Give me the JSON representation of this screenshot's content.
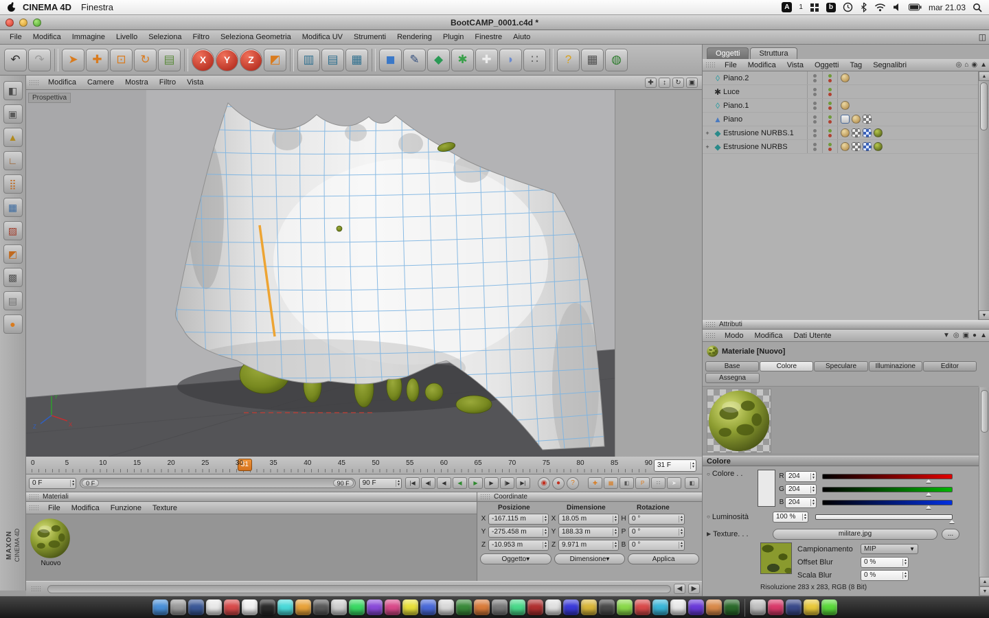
{
  "macbar": {
    "app": "CINEMA 4D",
    "menu": "Finestra",
    "clock": "mar 21.03",
    "input_letter": "A",
    "input_num": "1",
    "b_badge": "b"
  },
  "window": {
    "title": "BootCAMP_0001.c4d *"
  },
  "app_menu": [
    "File",
    "Modifica",
    "Immagine",
    "Livello",
    "Seleziona",
    "Filtro",
    "Seleziona Geometria",
    "Modifica UV",
    "Strumenti",
    "Rendering",
    "Plugin",
    "Finestre",
    "Aiuto"
  ],
  "toolbar": [
    {
      "n": "undo-icon",
      "g": "↶",
      "c": "#2f2f2f"
    },
    {
      "n": "redo-icon",
      "g": "↷",
      "c": "#9a9a9a"
    },
    {
      "sep": true
    },
    {
      "n": "live-selection-icon",
      "g": "➤",
      "c": "#d97b1e"
    },
    {
      "n": "move-icon",
      "g": "✚",
      "c": "#d97b1e"
    },
    {
      "n": "scale-icon",
      "g": "⊡",
      "c": "#d97b1e"
    },
    {
      "n": "rotate-icon",
      "g": "↻",
      "c": "#d97b1e"
    },
    {
      "n": "last-tool-icon",
      "g": "▤",
      "c": "#5a8a3a"
    },
    {
      "sep": true
    },
    {
      "n": "lock-x-button",
      "g": "X",
      "c": "#ffffff",
      "bg": "radial-gradient(circle at 35% 30%, #f0705a, #a82014)",
      "round": true
    },
    {
      "n": "lock-y-button",
      "g": "Y",
      "c": "#ffffff",
      "bg": "radial-gradient(circle at 35% 30%, #f0705a, #a82014)",
      "round": true
    },
    {
      "n": "lock-z-button",
      "g": "Z",
      "c": "#ffffff",
      "bg": "radial-gradient(circle at 35% 30%, #f0705a, #a82014)",
      "round": true
    },
    {
      "n": "coord-system-icon",
      "g": "◩",
      "c": "#d97b1e"
    },
    {
      "sep": true
    },
    {
      "n": "render-view-icon",
      "g": "▥",
      "c": "#2e6f8e"
    },
    {
      "n": "render-region-icon",
      "g": "▤",
      "c": "#2e6f8e"
    },
    {
      "n": "render-settings-icon",
      "g": "▦",
      "c": "#2e6f8e"
    },
    {
      "sep": true
    },
    {
      "n": "add-primitive-icon",
      "g": "◼",
      "c": "#3a78c8"
    },
    {
      "n": "add-spline-icon",
      "g": "✎",
      "c": "#35507e"
    },
    {
      "n": "add-nurbs-icon",
      "g": "◆",
      "c": "#2a9a55"
    },
    {
      "n": "add-modeling-icon",
      "g": "✱",
      "c": "#3aa04a"
    },
    {
      "n": "add-deformer-icon",
      "g": "✚",
      "c": "#ececec"
    },
    {
      "n": "add-scene-icon",
      "g": "◗",
      "c": "#6a8ad0"
    },
    {
      "n": "add-particles-icon",
      "g": "∷",
      "c": "#5f5f5f"
    },
    {
      "sep": true
    },
    {
      "n": "help-icon",
      "g": "?",
      "c": "#d9a21e"
    },
    {
      "n": "content-browser-icon",
      "g": "▦",
      "c": "#4f4f4f"
    },
    {
      "n": "online-help-icon",
      "g": "◍",
      "c": "#2a7a2a"
    }
  ],
  "left_tools": [
    {
      "n": "make-editable-icon",
      "g": "◧",
      "c": "#4a4a4a"
    },
    {
      "n": "model-mode-icon",
      "g": "▣",
      "c": "#5a5a5a"
    },
    {
      "n": "texture-mode-icon",
      "g": "▲",
      "c": "#b08a20"
    },
    {
      "n": "workplane-mode-icon",
      "g": "∟",
      "c": "#9a5a20"
    },
    {
      "n": "points-mode-icon",
      "g": "⣿",
      "c": "#c06a20"
    },
    {
      "n": "edges-mode-icon",
      "g": "▦",
      "c": "#3a6aa0"
    },
    {
      "n": "polygons-mode-icon",
      "g": "▨",
      "c": "#a03a28"
    },
    {
      "n": "texture-axis-mode-icon",
      "g": "◩",
      "c": "#c06a20"
    },
    {
      "n": "uv-mode-icon",
      "g": "▩",
      "c": "#555555"
    },
    {
      "n": "kinematics-mode-icon",
      "g": "▤",
      "c": "#6f6f6f"
    },
    {
      "n": "snap-settings-icon",
      "g": "●",
      "c": "#d97b1e"
    }
  ],
  "viewport": {
    "label": "Prospettiva",
    "menus": [
      "Modifica",
      "Camere",
      "Mostra",
      "Filtro",
      "Vista"
    ],
    "nav": [
      {
        "n": "pan-view-icon",
        "g": "✚"
      },
      {
        "n": "dolly-view-icon",
        "g": "↕"
      },
      {
        "n": "rotate-view-icon",
        "g": "↻"
      },
      {
        "n": "toggle-view-icon",
        "g": "▣"
      }
    ]
  },
  "timeline": {
    "ticks": [
      0,
      5,
      10,
      15,
      20,
      25,
      30,
      35,
      40,
      45,
      50,
      55,
      60,
      65,
      70,
      75,
      80,
      85,
      90
    ],
    "current": 31,
    "marker_label": "31",
    "field": "31 F"
  },
  "playback": {
    "start_field": "0 F",
    "end_field": "90 F",
    "range_start": "0 F",
    "range_end": "90 F",
    "transport": [
      {
        "n": "goto-start-button",
        "g": "|◀",
        "c": "#333333"
      },
      {
        "n": "prev-key-button",
        "g": "◀|",
        "c": "#333333"
      },
      {
        "n": "prev-frame-button",
        "g": "◀",
        "c": "#333333"
      },
      {
        "n": "play-backward-button",
        "g": "◀",
        "c": "#2e8a2e"
      },
      {
        "n": "play-button",
        "g": "▶",
        "c": "#2e8a2e"
      },
      {
        "n": "next-frame-button",
        "g": "▶",
        "c": "#333333"
      },
      {
        "n": "next-key-button",
        "g": "|▶",
        "c": "#333333"
      },
      {
        "n": "goto-end-button",
        "g": "▶|",
        "c": "#333333"
      }
    ],
    "record": [
      {
        "n": "record-keyframe-button",
        "g": "◉",
        "c": "#c23020"
      },
      {
        "n": "autokey-button",
        "g": "●",
        "c": "#c23020"
      },
      {
        "n": "keyframe-options-button",
        "g": "?",
        "c": "#d97b1e"
      }
    ],
    "snap": [
      {
        "n": "snap-toggle-icon",
        "g": "✚",
        "c": "#d97b1e"
      },
      {
        "n": "grid-snap-icon",
        "g": "▦",
        "c": "#d97b1e"
      },
      {
        "n": "workplane-snap-icon",
        "g": "◧",
        "c": "#555555"
      },
      {
        "n": "snap-p-icon",
        "g": "P",
        "c": "#d97b1e"
      },
      {
        "n": "quantize-icon",
        "g": "∷",
        "c": "#555555"
      },
      {
        "n": "selection-arrow-icon",
        "g": "➤",
        "c": "#eeeeee"
      }
    ],
    "corner": {
      "n": "layout-cube-icon",
      "g": "◧",
      "c": "#444444"
    }
  },
  "materials": {
    "title": "Materiali",
    "menus": [
      "File",
      "Modifica",
      "Funzione",
      "Texture"
    ],
    "items": [
      {
        "name": "Nuovo"
      }
    ]
  },
  "coordinate": {
    "title": "Coordinate",
    "columns": [
      "Posizione",
      "Dimensione",
      "Rotazione"
    ],
    "rows": [
      [
        "X",
        "-167.115 m",
        "X",
        "18.05 m",
        "H",
        "0 °"
      ],
      [
        "Y",
        "-275.458 m",
        "Y",
        "188.33 m",
        "P",
        "0 °"
      ],
      [
        "Z",
        "-10.953 m",
        "Z",
        "9.971 m",
        "B",
        "0 °"
      ]
    ],
    "buttons": [
      {
        "label": "Oggetto",
        "dd": true
      },
      {
        "label": "Dimensione",
        "dd": true
      },
      {
        "label": "Applica",
        "dd": false
      }
    ]
  },
  "object_manager": {
    "tabs": [
      "Oggetti",
      "Struttura"
    ],
    "active_tab": "Oggetti",
    "menus": [
      "File",
      "Modifica",
      "Vista",
      "Oggetti",
      "Tag",
      "Segnalibri"
    ],
    "icons": [
      {
        "n": "search-icon",
        "g": "◎"
      },
      {
        "n": "home-icon",
        "g": "⌂"
      },
      {
        "n": "focus-icon",
        "g": "◉"
      },
      {
        "n": "panel-up-icon",
        "g": "▲"
      }
    ],
    "objects": [
      {
        "name": "Piano.2",
        "icon": "plane-object-icon",
        "glyph": "◊",
        "color": "#1f9aa0",
        "expand": false,
        "tags": [
          "phong"
        ]
      },
      {
        "name": "Luce",
        "icon": "light-object-icon",
        "glyph": "✱",
        "color": "#2a2a2a",
        "expand": false,
        "tags": []
      },
      {
        "name": "Piano.1",
        "icon": "plane-object-icon",
        "glyph": "◊",
        "color": "#1f9aa0",
        "expand": false,
        "tags": [
          "phong"
        ]
      },
      {
        "name": "Piano",
        "icon": "polygon-object-icon",
        "glyph": "▲",
        "color": "#4a7ac0",
        "expand": false,
        "tags": [
          "selection",
          "phong",
          "texture"
        ]
      },
      {
        "name": "Estrusione NURBS.1",
        "icon": "extrude-nurbs-icon",
        "glyph": "◆",
        "color": "#2a8a8a",
        "expand": true,
        "tags": [
          "phong",
          "texture",
          "uvw",
          "material"
        ]
      },
      {
        "name": "Estrusione NURBS",
        "icon": "extrude-nurbs-icon",
        "glyph": "◆",
        "color": "#2a8a8a",
        "expand": true,
        "tags": [
          "phong",
          "texture",
          "uvw",
          "material"
        ]
      }
    ]
  },
  "attributes": {
    "title": "Attributi",
    "menus": [
      "Modo",
      "Modifica",
      "Dati Utente"
    ],
    "icons": [
      {
        "n": "filter-icon",
        "g": "▼"
      },
      {
        "n": "search-icon",
        "g": "◎"
      },
      {
        "n": "lock-icon",
        "g": "▣"
      },
      {
        "n": "user-icon",
        "g": "●"
      },
      {
        "n": "panel-up-icon",
        "g": "▲"
      }
    ],
    "object": "Materiale [Nuovo]",
    "tabs": [
      "Base",
      "Colore",
      "Speculare",
      "Illuminazione",
      "Editor"
    ],
    "active_tab": "Colore",
    "tab_row2": "Assegna",
    "color": {
      "header": "Colore",
      "label": "Colore . .",
      "channels": [
        {
          "l": "R",
          "v": "204",
          "grad": "#e00000"
        },
        {
          "l": "G",
          "v": "204",
          "grad": "#00b400"
        },
        {
          "l": "B",
          "v": "204",
          "grad": "#0030e0"
        }
      ],
      "marker_pct": 80,
      "luminosita_label": "Luminosità",
      "luminosita": "100 %",
      "texture_label": "Texture. . .",
      "texture_file": "militare.jpg",
      "more": "...",
      "campionamento_label": "Campionamento",
      "campionamento": "MIP",
      "offset_label": "Offset Blur",
      "offset": "0 %",
      "scala_label": "Scala Blur",
      "scala": "0 %",
      "risoluzione": "Risoluzione 283 x 283, RGB (8 Bit)"
    }
  },
  "brand": {
    "maxon": "MAXON",
    "cinema": "CINEMA 4D"
  },
  "dock": {
    "colors": [
      "#4a90d9",
      "#9b9b9b",
      "#3b5998",
      "#e8e8e8",
      "#d84a4a",
      "#f0f0f0",
      "#2a2a2a",
      "#4ad9d9",
      "#e8a33a",
      "#5a5a5a",
      "#d0d0d0",
      "#3ad964",
      "#8a4ad9",
      "#d94a8a",
      "#e8e13a",
      "#4a6ad9",
      "#d9d9d9",
      "#3a8a3a",
      "#d97b3a",
      "#7a7a7a",
      "#4ad98a",
      "#b03030",
      "#e0e0e0",
      "#3a3ad9",
      "#d9b63a",
      "#4a4a4a",
      "#8ad94a",
      "#d94a4a",
      "#3ab6d9",
      "#e8e8e8",
      "#6a3ad9",
      "#d98a4a",
      "#2a6a2a",
      "#c0c0c0",
      "#d93a6a",
      "#3a4a8a",
      "#e8c83a",
      "#5ad93a"
    ]
  }
}
